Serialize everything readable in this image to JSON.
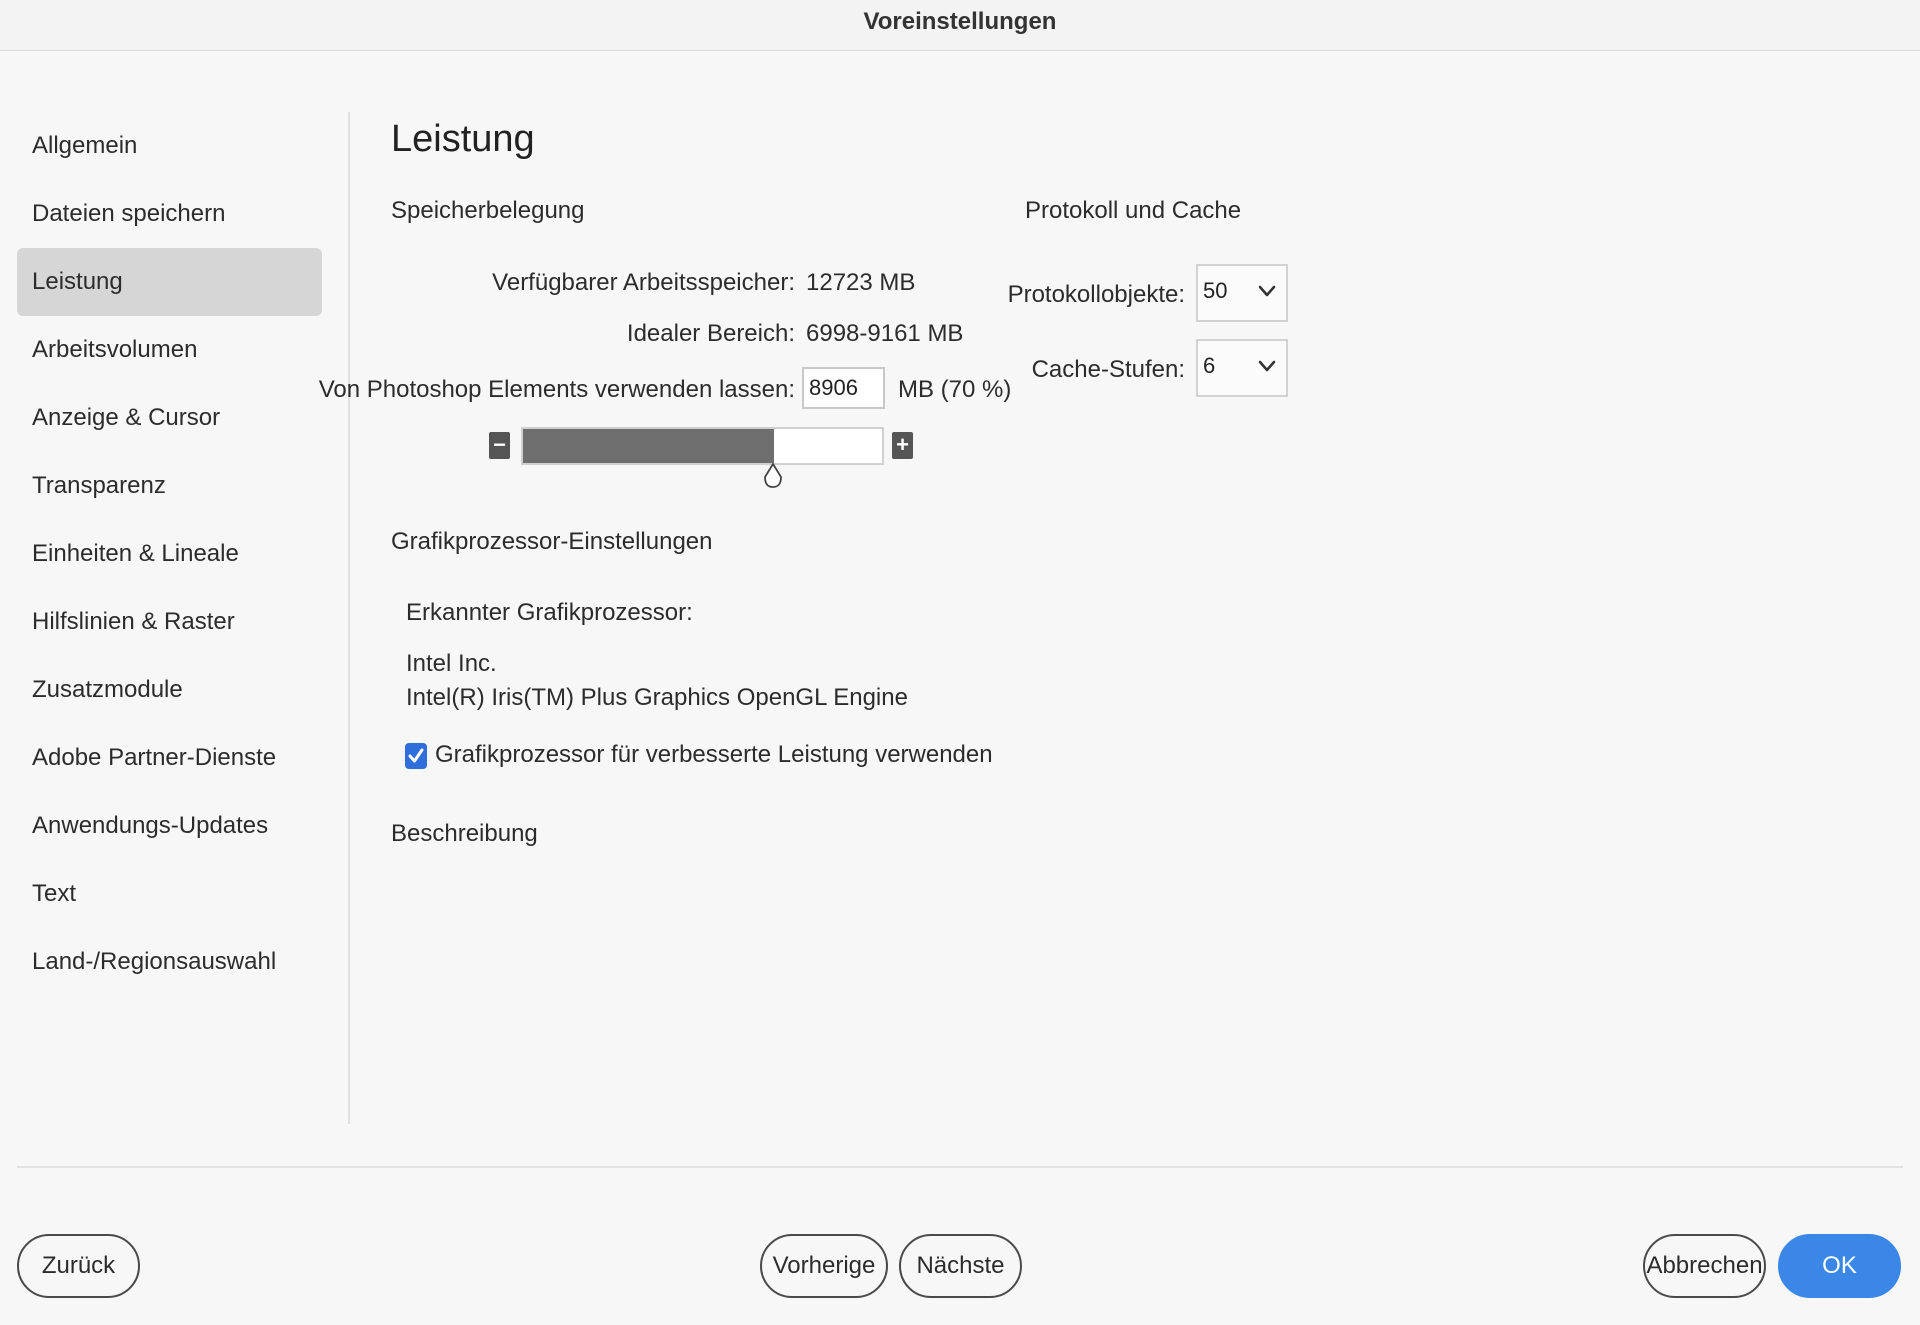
{
  "window": {
    "title": "Voreinstellungen"
  },
  "sidebar": {
    "items": [
      {
        "label": "Allgemein"
      },
      {
        "label": "Dateien speichern"
      },
      {
        "label": "Leistung"
      },
      {
        "label": "Arbeitsvolumen"
      },
      {
        "label": "Anzeige & Cursor"
      },
      {
        "label": "Transparenz"
      },
      {
        "label": "Einheiten & Lineale"
      },
      {
        "label": "Hilfslinien & Raster"
      },
      {
        "label": "Zusatzmodule"
      },
      {
        "label": "Adobe Partner-Dienste"
      },
      {
        "label": "Anwendungs-Updates"
      },
      {
        "label": "Text"
      },
      {
        "label": "Land-/Regionsauswahl"
      }
    ],
    "selected": "Leistung"
  },
  "main": {
    "title": "Leistung",
    "memory": {
      "heading": "Speicherbelegung",
      "available_label": "Verfügbarer Arbeitsspeicher:",
      "available_value": "12723 MB",
      "ideal_label": "Idealer Bereich:",
      "ideal_value": "6998-9161 MB",
      "use_label": "Von Photoshop Elements verwenden lassen:",
      "use_value": "8906",
      "use_unit": "MB (70 %)",
      "slider_percent": 70,
      "minus_symbol": "−",
      "plus_symbol": "+"
    },
    "cache": {
      "heading": "Protokoll und Cache",
      "history_label": "Protokollobjekte:",
      "history_value": "50",
      "levels_label": "Cache-Stufen:",
      "levels_value": "6"
    },
    "gpu": {
      "heading": "Grafikprozessor-Einstellungen",
      "detected_label": "Erkannter Grafikprozessor:",
      "vendor": "Intel Inc.",
      "renderer": "Intel(R) Iris(TM) Plus Graphics OpenGL Engine",
      "use_gpu_label": "Grafikprozessor für verbesserte Leistung verwenden",
      "use_gpu_checked": true
    },
    "description": {
      "heading": "Beschreibung"
    }
  },
  "footer": {
    "back_label": "Zurück",
    "prev_label": "Vorherige",
    "next_label": "Nächste",
    "cancel_label": "Abbrechen",
    "ok_label": "OK"
  },
  "colors": {
    "accent": "#3b87e8",
    "checkbox": "#2f6fdb",
    "selected_item_bg": "#d6d6d6",
    "slider_fill": "#6e6e6e"
  }
}
